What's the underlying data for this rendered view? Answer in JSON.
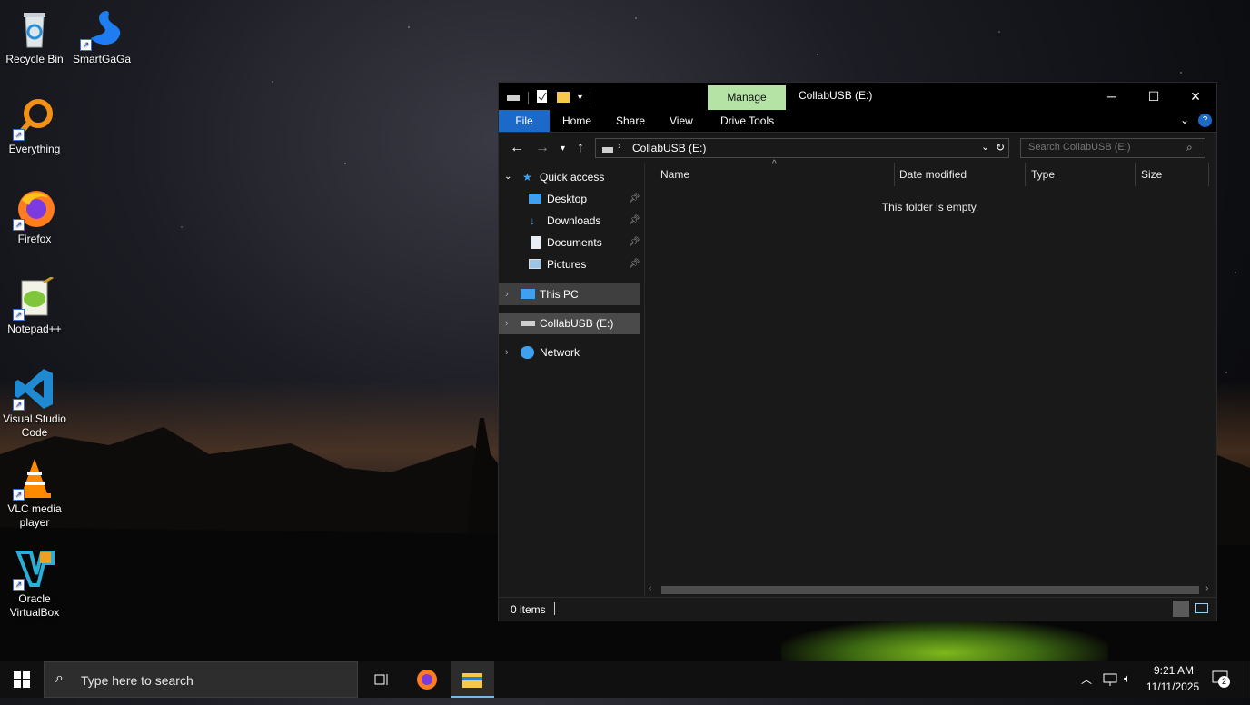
{
  "desktop": {
    "icons": [
      {
        "label": "Recycle Bin",
        "icon": "recycle-bin-icon"
      },
      {
        "label": "SmartGaGa",
        "icon": "smartgaga-icon"
      },
      {
        "label": "Everything",
        "icon": "everything-search-icon"
      },
      {
        "label": "Firefox",
        "icon": "firefox-icon"
      },
      {
        "label": "Notepad++",
        "icon": "notepadpp-icon"
      },
      {
        "label": "Visual Studio Code",
        "icon": "vscode-icon"
      },
      {
        "label": "VLC media player",
        "icon": "vlc-icon"
      },
      {
        "label": "Oracle VirtualBox",
        "icon": "virtualbox-icon"
      }
    ]
  },
  "explorer": {
    "title": "CollabUSB (E:)",
    "context_tab": "Manage",
    "ribbon_tabs": [
      "File",
      "Home",
      "Share",
      "View",
      "Drive Tools"
    ],
    "address": {
      "path": "CollabUSB (E:)"
    },
    "search": {
      "placeholder": "Search CollabUSB (E:)"
    },
    "nav": {
      "quick_access": "Quick access",
      "pinned": [
        "Desktop",
        "Downloads",
        "Documents",
        "Pictures"
      ],
      "this_pc": "This PC",
      "drive": "CollabUSB (E:)",
      "network": "Network"
    },
    "columns": [
      "Name",
      "Date modified",
      "Type",
      "Size"
    ],
    "empty_message": "This folder is empty.",
    "status": {
      "items": "0 items"
    },
    "colors": {
      "file_tab": "#1b6ac9",
      "manage_tab": "#b5e3a6",
      "selection": "#3f3f3f"
    }
  },
  "taskbar": {
    "search_placeholder": "Type here to search",
    "time": "9:21 AM",
    "date": "11/11/2025",
    "notification_count": "2"
  }
}
